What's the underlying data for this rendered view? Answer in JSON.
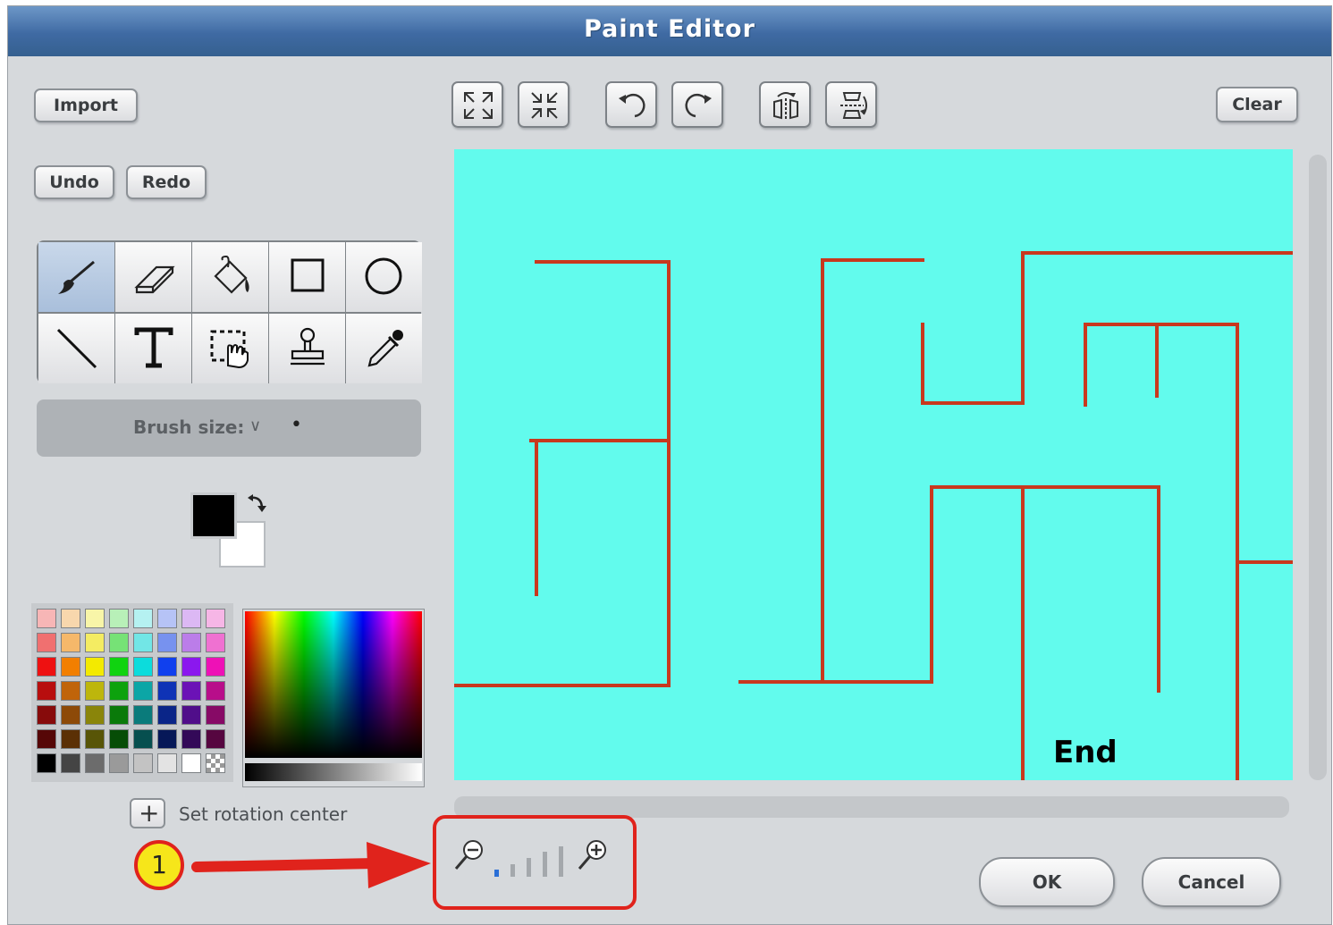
{
  "window": {
    "title": "Paint Editor"
  },
  "buttons": {
    "import": "Import",
    "undo": "Undo",
    "redo": "Redo",
    "clear": "Clear",
    "ok": "OK",
    "cancel": "Cancel"
  },
  "canvas_toolbar": [
    "grow-icon",
    "shrink-icon",
    "rotate-left-icon",
    "rotate-right-icon",
    "flip-horizontal-icon",
    "flip-vertical-icon"
  ],
  "tools": [
    "paintbrush-icon",
    "eraser-icon",
    "fill-bucket-icon",
    "rectangle-icon",
    "ellipse-icon",
    "line-icon",
    "text-icon",
    "select-icon",
    "stamp-icon",
    "eyedropper-icon"
  ],
  "selected_tool": "paintbrush-icon",
  "brush": {
    "label": "Brush size:",
    "chevron": "∨",
    "preview": "•"
  },
  "colors": {
    "foreground": "#000000",
    "background": "#ffffff"
  },
  "palette": [
    [
      "#f7b6b6",
      "#f8d7ad",
      "#f8f5a8",
      "#b8f0b8",
      "#b5f1f1",
      "#b6c3f6",
      "#dcb8f4",
      "#f6b6e6"
    ],
    [
      "#f07070",
      "#f5b86a",
      "#f4ec62",
      "#76e276",
      "#72e6e6",
      "#7792ef",
      "#bb7de9",
      "#ef71d1"
    ],
    [
      "#ee1111",
      "#f27f00",
      "#f3ea00",
      "#10d310",
      "#0cdcdc",
      "#1040ee",
      "#8b18ee",
      "#ee11b6"
    ],
    [
      "#b80e0e",
      "#c0640a",
      "#bdb60c",
      "#0da20d",
      "#0ca6a6",
      "#0f33b6",
      "#6b12b6",
      "#b80e8a"
    ],
    [
      "#870b0b",
      "#8d4a08",
      "#8a850a",
      "#0a7a0a",
      "#0a7b7b",
      "#0a2588",
      "#500e8a",
      "#870a66"
    ],
    [
      "#560707",
      "#5b3005",
      "#585507",
      "#064d06",
      "#064f4f",
      "#061858",
      "#330958",
      "#560640"
    ],
    [
      "#000000",
      "#444444",
      "#6c6c6c",
      "#9a9a9a",
      "#c3c3c3",
      "#e3e3e3",
      "#ffffff",
      "checker"
    ]
  ],
  "rotation_center": {
    "label": "Set rotation center",
    "icon": "plus-icon"
  },
  "zoom": {
    "level_index": 1,
    "levels": 5,
    "out_icon": "zoom-out-icon",
    "in_icon": "zoom-in-icon"
  },
  "canvas": {
    "background": "#62fbed",
    "line_color": "#c8381e",
    "label": "End"
  },
  "annotation": {
    "number": "1"
  }
}
